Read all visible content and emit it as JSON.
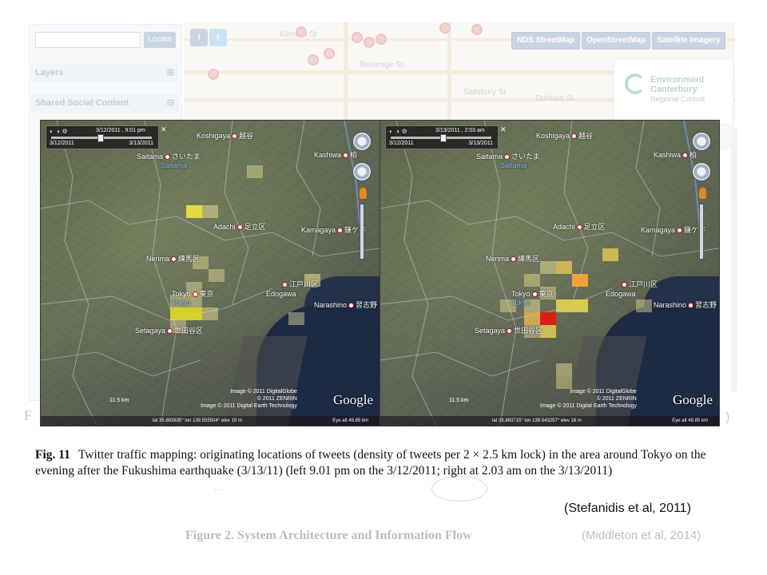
{
  "background_app": {
    "locate_label": "Locate",
    "social": [
      "f",
      "t"
    ],
    "layer_buttons": [
      "NDS StreetMap",
      "OpenStreetMap",
      "Satellite Imagery"
    ],
    "sections": [
      {
        "label": "Layers",
        "toggle": "⊞"
      },
      {
        "label": "Shared Social Content",
        "toggle": "⊟"
      }
    ],
    "streets": [
      "Beverage St",
      "Salisbury St",
      "Durham St",
      "Kilmore St"
    ],
    "logo": {
      "line1": "Environment",
      "line2": "Canterbury",
      "line3": "Regional Council"
    },
    "bottom_left_fragment": "F",
    "bottom_right_fragment": ")",
    "note": "...",
    "figure_caption": "Figure 2. System Architecture and Information Flow",
    "citation": "(Middleton et al, 2014)"
  },
  "panels": [
    {
      "current_time": "3/12/2011 , 9:01 pm",
      "range_start": "3/12/2011",
      "range_end": "3/13/2011",
      "slider_fraction": 0.48,
      "places": [
        {
          "name": "Koshigaya",
          "jp": "越谷"
        },
        {
          "name": "Saitama",
          "jp": "さいたま",
          "sub": "Saitama"
        },
        {
          "name": "Kashiwa",
          "jp": "柏"
        },
        {
          "name": "Adachi",
          "jp": "足立区"
        },
        {
          "name": "Kamagaya",
          "jp": "鎌ケ谷"
        },
        {
          "name": "Nerima",
          "jp": "練馬区"
        },
        {
          "name": "江戸川区",
          "jp": ""
        },
        {
          "name": "Tokyo",
          "jp": "東京",
          "sub": "Tokyo"
        },
        {
          "name": "Edogawa",
          "jp": ""
        },
        {
          "name": "Narashino",
          "jp": "習志野"
        },
        {
          "name": "Setagaya",
          "jp": "世田谷区"
        }
      ],
      "scale": "11.5 km",
      "credit": "Image © 2011 DigitalGlobe\n© 2011 ZENRIN\nImage © 2011 Digital Earth Technology",
      "coords": "lat 35.883835° lon 139.555504° elev 19 m",
      "eye": "Eye alt 49.85 km",
      "brand": "Google"
    },
    {
      "current_time": "3/13/2011 , 2:03 am",
      "range_start": "3/12/2011",
      "range_end": "3/13/2011",
      "slider_fraction": 0.52,
      "places": [
        {
          "name": "Koshigaya",
          "jp": "越谷"
        },
        {
          "name": "Saitama",
          "jp": "さいたま",
          "sub": "Saitama"
        },
        {
          "name": "Kashiwa",
          "jp": "柏"
        },
        {
          "name": "Adachi",
          "jp": "足立区"
        },
        {
          "name": "Kamagaya",
          "jp": "鎌ケ谷"
        },
        {
          "name": "Nerima",
          "jp": "練馬区"
        },
        {
          "name": "江戸川区",
          "jp": ""
        },
        {
          "name": "Tokyo",
          "jp": "東京",
          "sub": "Tokyo"
        },
        {
          "name": "Edogawa",
          "jp": ""
        },
        {
          "name": "Narashino",
          "jp": "習志野"
        },
        {
          "name": "Setagaya",
          "jp": "世田谷区"
        }
      ],
      "scale": "11.5 km",
      "credit": "Image © 2011 DigitalGlobe\n© 2011 ZENRIN\nImage © 2011 Digital Earth Technology",
      "coords": "lat 35.883715° lon 139.543257° elev 16 m",
      "eye": "Eye alt 49.85 km",
      "brand": "Google"
    }
  ],
  "caption": {
    "label": "Fig. 11",
    "text": "Twitter traffic mapping: originating locations of tweets (density of tweets per 2 × 2.5 km lock) in the area around Tokyo on the evening after the Fukushima earthquake (3/13/11) (left 9.01 pm on the 3/12/2011; right at 2.03 am on the 3/13/2011)"
  },
  "citation": "(Stefanidis et al, 2011)",
  "colors": {
    "density_low": "#e8e070",
    "density_mid": "#f2a53a",
    "density_high": "#e01b12",
    "water": "#1d2a43"
  }
}
